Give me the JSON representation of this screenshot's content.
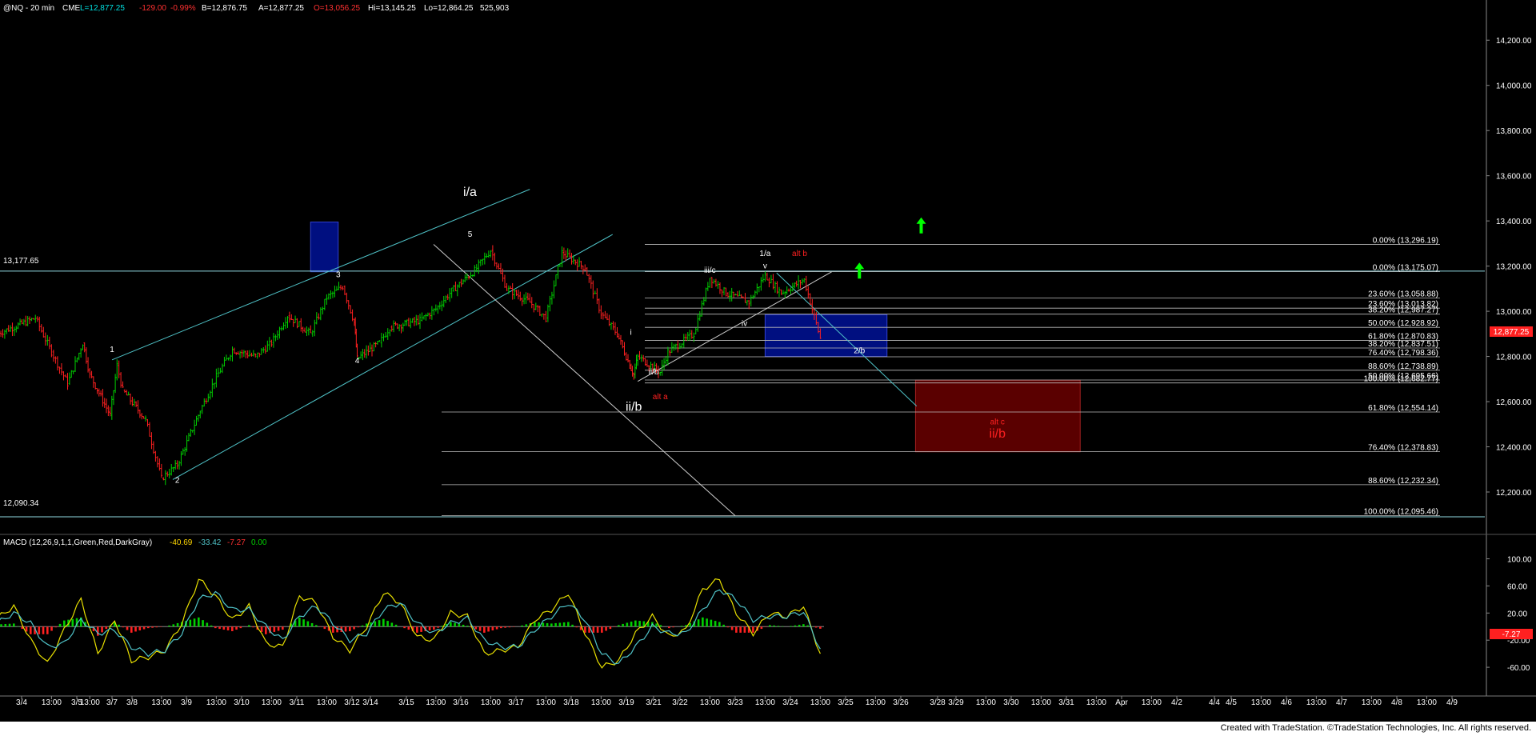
{
  "header": {
    "symbol": "@NQ - 20 min",
    "exchange": "CME",
    "last": "L=12,877.25",
    "change": "-129.00",
    "pct": "-0.99%",
    "bid": "B=12,876.75",
    "ask": "A=12,877.25",
    "open": "O=13,056.25",
    "high": "Hi=13,145.25",
    "low": "Lo=12,864.25",
    "volume": "525,903"
  },
  "footer": {
    "text": "Created with TradeStation. ©TradeStation Technologies, Inc. All rights reserved."
  },
  "colors": {
    "up": "#00d000",
    "down": "#ff2020",
    "grid": "#3a3a3a",
    "trend": "#4fc3c8",
    "blue_box": "#000f80",
    "red_box": "#5a0000",
    "text": "#ffffff",
    "red_text": "#ff2020"
  },
  "chart_data": [
    {
      "type": "line",
      "title": "",
      "price_axis_ticks": [
        "14,200.00",
        "14,000.00",
        "13,800.00",
        "13,600.00",
        "13,400.00",
        "13,200.00",
        "13,000.00",
        "12,800.00",
        "12,600.00",
        "12,400.00",
        "12,200.00"
      ],
      "ylim": [
        12030,
        14300
      ],
      "last_price_marker": "12,877.25",
      "reference_levels": [
        {
          "label": "13,177.65",
          "value": 13177.65
        },
        {
          "label": "12,090.34",
          "value": 12090.34
        }
      ],
      "fib_levels": [
        {
          "label": "0.00% (13,296.19)",
          "value": 13296.19,
          "group": "upper"
        },
        {
          "label": "0.00% (13,175.07)",
          "value": 13175.07,
          "group": "upper"
        },
        {
          "label": "23.60% (13,058.88)",
          "value": 13058.88,
          "group": "upper"
        },
        {
          "label": "23.60% (13,013.82)",
          "value": 13013.82,
          "group": "upper"
        },
        {
          "label": "38.20% (12,987.27)",
          "value": 12987.27,
          "group": "upper"
        },
        {
          "label": "50.00% (12,928.92)",
          "value": 12928.92,
          "group": "upper"
        },
        {
          "label": "61.80% (12,870.83)",
          "value": 12870.83,
          "group": "upper"
        },
        {
          "label": "38.20% (12,837.51)",
          "value": 12837.51,
          "group": "upper"
        },
        {
          "label": "76.40% (12,798.36)",
          "value": 12798.36,
          "group": "upper"
        },
        {
          "label": "88.60% (12,738.89)",
          "value": 12738.89,
          "group": "upper"
        },
        {
          "label": "50.00% (12,695.66)",
          "value": 12695.66,
          "group": "upper"
        },
        {
          "label": "100.00% (12,682.77)",
          "value": 12682.77,
          "group": "upper"
        },
        {
          "label": "61.80% (12,554.14)",
          "value": 12554.14,
          "group": "lower"
        },
        {
          "label": "76.40% (12,378.83)",
          "value": 12378.83,
          "group": "lower"
        },
        {
          "label": "88.60% (12,232.34)",
          "value": 12232.34,
          "group": "lower"
        },
        {
          "label": "100.00% (12,095.46)",
          "value": 12095.46,
          "group": "lower"
        }
      ],
      "zones": [
        {
          "name": "blue-box-left",
          "color": "blue",
          "x": [
            "3/11 06:00",
            "3/11 18:00"
          ],
          "y": [
            13175,
            13395
          ]
        },
        {
          "name": "blue-box-target",
          "color": "blue",
          "x": [
            "3/23 13:00",
            "3/25 18:00"
          ],
          "y": [
            12800,
            12985
          ]
        },
        {
          "name": "red-box-target",
          "color": "red",
          "x": [
            "3/26 13:00",
            "3/31 06:00"
          ],
          "y": [
            12378,
            12695
          ]
        }
      ],
      "wave_labels": [
        {
          "text": "1",
          "x": "3/7 00:00",
          "y": 12820,
          "color": "white"
        },
        {
          "text": "2",
          "x": "3/8 20:00",
          "y": 12240,
          "color": "white"
        },
        {
          "text": "3",
          "x": "3/11 18:00",
          "y": 13150,
          "color": "white"
        },
        {
          "text": "4",
          "x": "3/12 13:00",
          "y": 12770,
          "color": "white"
        },
        {
          "text": "5",
          "x": "3/16 04:00",
          "y": 13330,
          "color": "white"
        },
        {
          "text": "i/a",
          "x": "3/16 04:00",
          "y": 13510,
          "color": "white",
          "large": true
        },
        {
          "text": "i",
          "x": "3/19 08:00",
          "y": 12895,
          "color": "white"
        },
        {
          "text": "ii/b",
          "x": "3/19 13:00",
          "y": 12560,
          "color": "white",
          "large": true
        },
        {
          "text": "ii/b",
          "x": "3/21 00:00",
          "y": 12720,
          "color": "white"
        },
        {
          "text": "alt a",
          "x": "3/21 06:00",
          "y": 12610,
          "color": "red"
        },
        {
          "text": "iii/c",
          "x": "3/22 13:00",
          "y": 13170,
          "color": "white"
        },
        {
          "text": "iv",
          "x": "3/23 04:00",
          "y": 12935,
          "color": "white"
        },
        {
          "text": "1/a",
          "x": "3/23 13:00",
          "y": 13245,
          "color": "white"
        },
        {
          "text": "v",
          "x": "3/23 13:00",
          "y": 13190,
          "color": "white"
        },
        {
          "text": "alt b",
          "x": "3/24 04:00",
          "y": 13245,
          "color": "red"
        },
        {
          "text": "2/b",
          "x": "3/25 06:00",
          "y": 12815,
          "color": "white"
        },
        {
          "text": "alt c",
          "x": "3/29 18:00",
          "y": 12500,
          "color": "red"
        },
        {
          "text": "ii/b",
          "x": "3/29 18:00",
          "y": 12440,
          "color": "red",
          "large": true
        }
      ],
      "arrows": [
        {
          "x": "3/25 06:00",
          "y": 13180,
          "color": "green"
        },
        {
          "x": "3/26 18:00",
          "y": 13380,
          "color": "green"
        }
      ],
      "x_ticks": [
        "3/4",
        "13:00",
        "3/5",
        "13:00",
        "3/7",
        "3/8",
        "13:00",
        "3/9",
        "13:00",
        "3/10",
        "13:00",
        "3/11",
        "13:00",
        "3/12",
        "3/14",
        "3/15",
        "13:00",
        "3/16",
        "13:00",
        "3/17",
        "13:00",
        "3/18",
        "13:00",
        "3/19",
        "3/21",
        "3/22",
        "13:00",
        "3/23",
        "13:00",
        "3/24",
        "13:00",
        "3/25",
        "13:00",
        "3/26",
        "3/28",
        "3/29",
        "13:00",
        "3/30",
        "13:00",
        "3/31",
        "13:00",
        "Apr",
        "13:00",
        "4/2",
        "4/4",
        "4/5",
        "13:00",
        "4/6",
        "13:00",
        "4/7",
        "13:00",
        "4/8",
        "13:00",
        "4/9"
      ],
      "price_series": {
        "name": "@NQ 20 min close",
        "x": [
          "3/3 13:00",
          "3/4 06:00",
          "3/4 13:00",
          "3/4 20:00",
          "3/5 06:00",
          "3/5 13:00",
          "3/6 20:00",
          "3/7 06:00",
          "3/7 13:00",
          "3/8 06:00",
          "3/8 13:00",
          "3/8 20:00",
          "3/9 06:00",
          "3/9 13:00",
          "3/9 20:00",
          "3/10 06:00",
          "3/10 13:00",
          "3/10 20:00",
          "3/11 06:00",
          "3/11 13:00",
          "3/11 20:00",
          "3/12 06:00",
          "3/12 13:00",
          "3/14 06:00",
          "3/14 13:00",
          "3/15 06:00",
          "3/15 13:00",
          "3/15 20:00",
          "3/16 06:00",
          "3/16 13:00",
          "3/16 20:00",
          "3/17 06:00",
          "3/17 13:00",
          "3/17 20:00",
          "3/18 06:00",
          "3/18 13:00",
          "3/18 20:00",
          "3/19 06:00",
          "3/19 13:00",
          "3/19 20:00",
          "3/21 06:00",
          "3/21 13:00",
          "3/22 06:00",
          "3/22 13:00",
          "3/22 20:00",
          "3/23 06:00",
          "3/23 13:00",
          "3/23 20:00",
          "3/24 06:00",
          "3/24 13:00"
        ],
        "values": [
          12900,
          12970,
          12820,
          12680,
          12860,
          12720,
          12540,
          12760,
          12650,
          12520,
          12260,
          12320,
          12560,
          12710,
          12830,
          12800,
          12860,
          12980,
          12900,
          13060,
          13110,
          12950,
          12790,
          12860,
          12930,
          12960,
          13010,
          13090,
          13180,
          13270,
          13100,
          13040,
          12970,
          13260,
          13190,
          12990,
          12900,
          12760,
          12720,
          12800,
          12730,
          12820,
          12900,
          13150,
          13080,
          13040,
          13160,
          13080,
          13140,
          12880
        ]
      }
    },
    {
      "type": "line",
      "title": "MACD (12,26,9,1,1,Green,Red,DarkGray)",
      "legend_values": [
        "-40.69",
        "-33.42",
        "-7.27",
        "0.00"
      ],
      "value_axis_ticks": [
        "100.00",
        "60.00",
        "20.00",
        "-20.00",
        "-60.00"
      ],
      "last_value_marker": "-7.27",
      "ylim": [
        -100,
        110
      ],
      "series": [
        {
          "name": "MACD",
          "x_from": "3/3 13:00",
          "x_to": "3/24 13:00",
          "values": [
            12,
            30,
            -20,
            -55,
            -5,
            40,
            -40,
            10,
            -50,
            -45,
            -35,
            5,
            70,
            45,
            10,
            30,
            -25,
            -30,
            45,
            35,
            -15,
            -35,
            0,
            50,
            35,
            -15,
            -20,
            20,
            15,
            -40,
            -35,
            -30,
            10,
            25,
            50,
            -10,
            -60,
            -50,
            -10,
            15,
            -15,
            -5,
            55,
            70,
            20,
            -10,
            20,
            15,
            30,
            -40
          ]
        },
        {
          "name": "Signal",
          "x_from": "3/3 13:00",
          "x_to": "3/24 13:00",
          "values": [
            5,
            20,
            5,
            -30,
            -25,
            10,
            -10,
            -5,
            -30,
            -40,
            -35,
            -10,
            40,
            50,
            25,
            25,
            0,
            -20,
            15,
            30,
            5,
            -20,
            -10,
            25,
            35,
            5,
            -10,
            5,
            12,
            -20,
            -30,
            -30,
            -5,
            15,
            35,
            10,
            -40,
            -55,
            -30,
            0,
            -10,
            -10,
            25,
            55,
            40,
            10,
            15,
            15,
            22,
            -33
          ]
        }
      ]
    }
  ]
}
